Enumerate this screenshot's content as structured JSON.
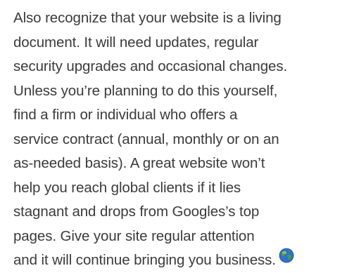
{
  "article": {
    "lines": [
      "Also recognize that your website is a living",
      "document. It will need updates, regular",
      "security upgrades and occasional changes.",
      "Unless you’re planning to do this yourself,",
      "find a firm or individual who offers a",
      "service contract (annual, monthly or on an",
      "as-needed basis). A great website won’t",
      "help you reach global clients if it lies",
      "stagnant and drops from Googles’s top",
      "pages. Give your site regular attention",
      "and it will continue bringing you business."
    ],
    "end_icon": "globe-icon"
  },
  "colors": {
    "text": "#3b3b3b",
    "globe_ocean": "#2e73c9",
    "globe_land": "#4f9a3a"
  }
}
